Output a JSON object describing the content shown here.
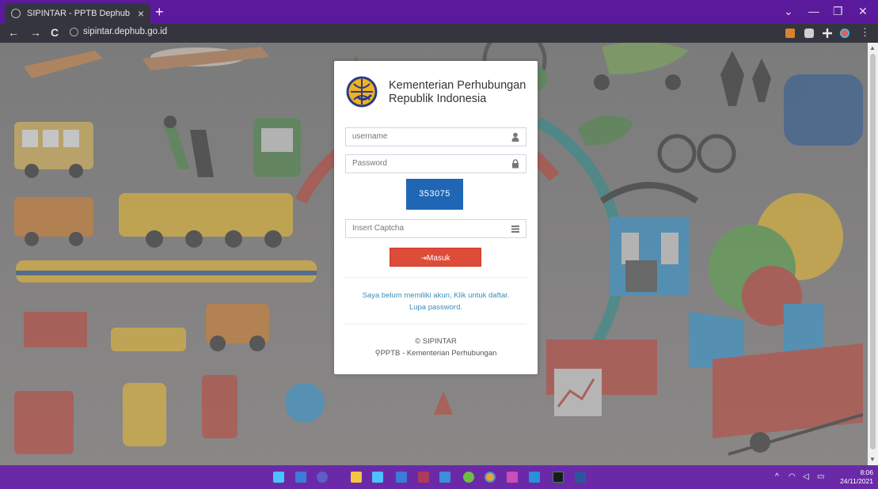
{
  "browser": {
    "tab_title": "SIPINTAR - PPTB Dephub",
    "tab_close": "×",
    "new_tab": "+",
    "url": "sipintar.dephub.go.id",
    "back": "←",
    "forward": "→",
    "reload": "C",
    "minimize": "—",
    "restore": "❐",
    "close": "✕",
    "dropdown": "⌄",
    "menu": "⋮"
  },
  "login": {
    "org_line1": "Kementerian Perhubungan",
    "org_line2": "Republik Indonesia",
    "username_placeholder": "username",
    "password_placeholder": "Password",
    "captcha_code": "353075",
    "captcha_placeholder": "Insert Captcha",
    "submit_label": "Masuk",
    "register_link": "Saya belum memiliki akun, Klik untuk daftar.",
    "forgot_link": "Lupa password.",
    "copyright": "© SIPINTAR",
    "location": "PPTB - Kementerian Perhubungan"
  },
  "taskbar": {
    "time": "8:06",
    "date": "24/11/2021",
    "tray_chevron": "^"
  },
  "colors": {
    "titlebar": "#5b1a9c",
    "captcha_bg": "#1f66b5",
    "submit_bg": "#dd4b39",
    "link": "#3c8dbc"
  }
}
